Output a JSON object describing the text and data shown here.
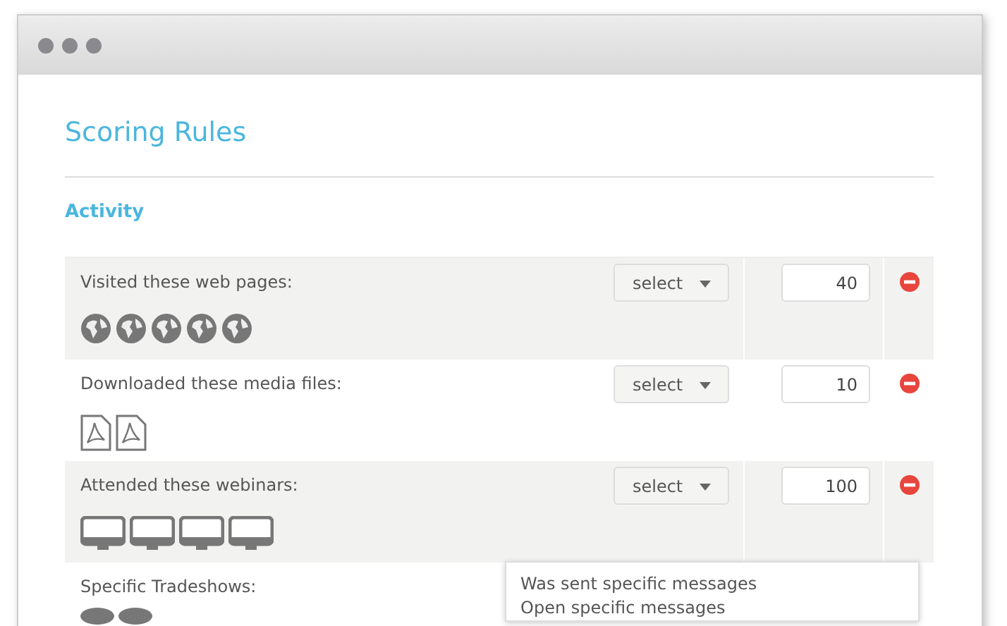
{
  "window": {
    "controls": [
      {
        "kind": "dot"
      },
      {
        "kind": "dot"
      },
      {
        "kind": "dot"
      }
    ]
  },
  "title": "Scoring Rules",
  "section": "Activity",
  "rules": [
    {
      "label": "Visited these web pages:",
      "select": "select",
      "score": "40",
      "icons": [
        {
          "kind": "globe"
        },
        {
          "kind": "globe"
        },
        {
          "kind": "globe"
        },
        {
          "kind": "globe"
        },
        {
          "kind": "globe"
        }
      ]
    },
    {
      "label": "Downloaded these media files:",
      "select": "select",
      "score": "10",
      "icons": [
        {
          "kind": "pdf"
        },
        {
          "kind": "pdf"
        }
      ]
    },
    {
      "label": "Attended these webinars:",
      "select": "select",
      "score": "100",
      "icons": [
        {
          "kind": "monitor"
        },
        {
          "kind": "monitor"
        },
        {
          "kind": "monitor"
        },
        {
          "kind": "monitor"
        }
      ]
    },
    {
      "label": "Specific Tradeshows:",
      "icons": [
        {
          "kind": "badge"
        },
        {
          "kind": "badge"
        }
      ]
    }
  ],
  "menu": {
    "items": [
      "Was sent specific messages",
      "Open specific messages"
    ]
  }
}
